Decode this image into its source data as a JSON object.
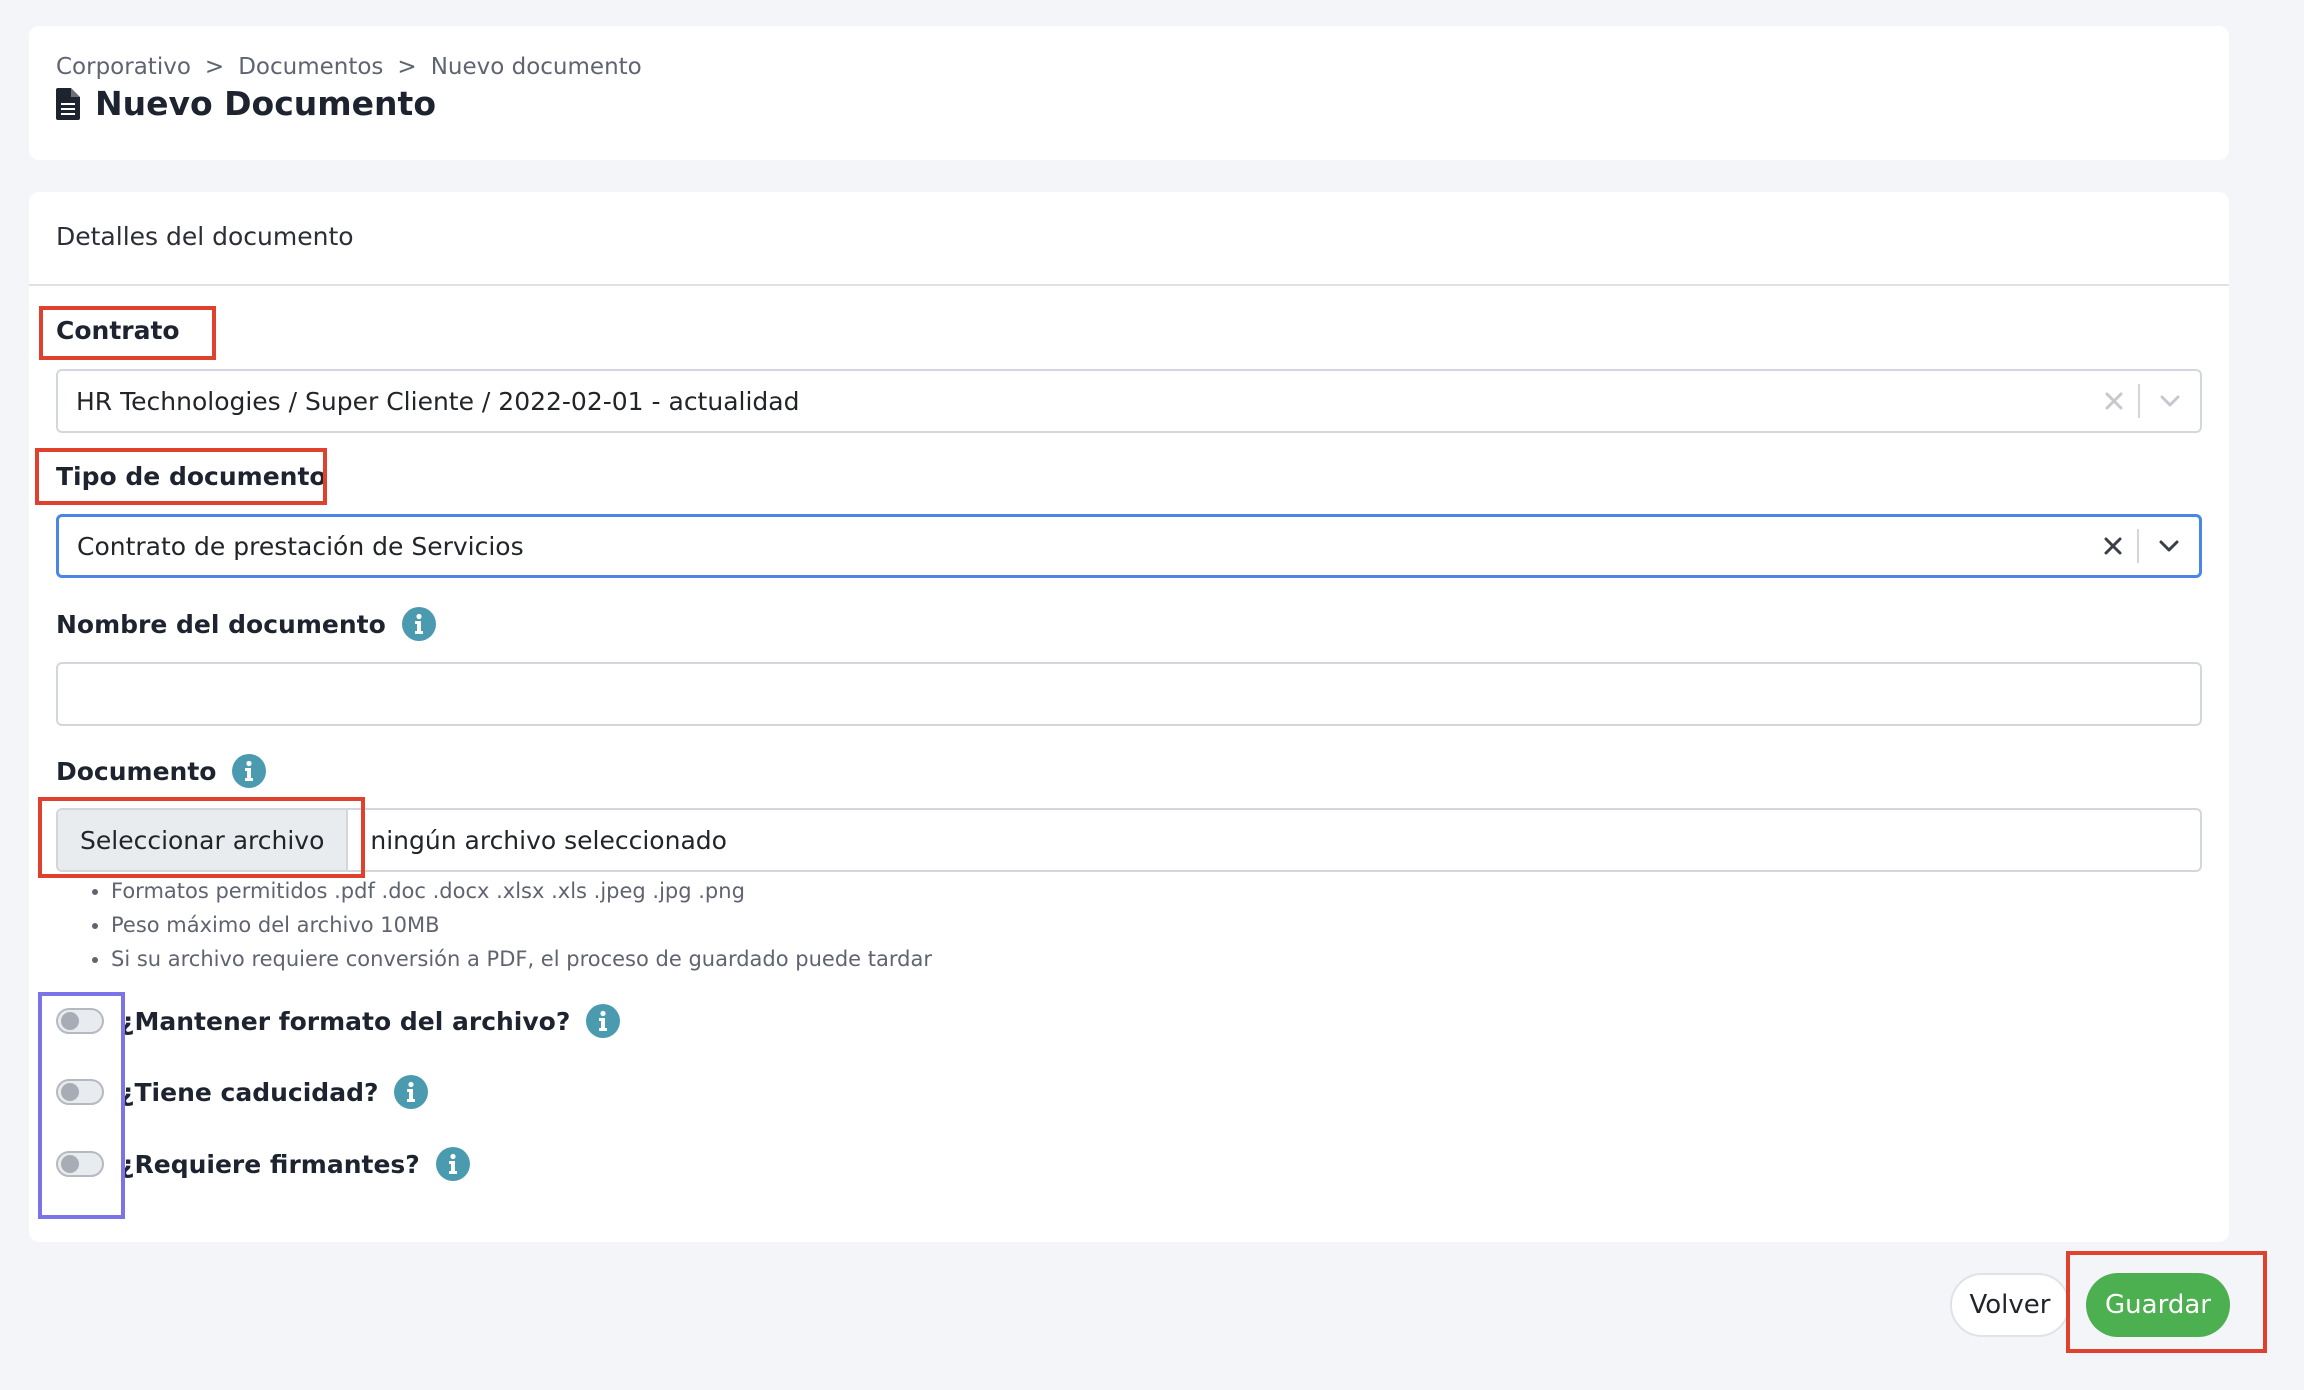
{
  "breadcrumb": {
    "items": [
      "Corporativo",
      "Documentos",
      "Nuevo documento"
    ],
    "separator": ">"
  },
  "page": {
    "title": "Nuevo Documento",
    "title_icon": "document-icon"
  },
  "form": {
    "section_title": "Detalles del documento",
    "contrato": {
      "label": "Contrato",
      "value": "HR Technologies / Super Cliente / 2022-02-01 - actualidad"
    },
    "tipo_documento": {
      "label": "Tipo de documento",
      "value": "Contrato de prestación de Servicios"
    },
    "nombre": {
      "label": "Nombre del documento",
      "value": "",
      "placeholder": ""
    },
    "documento": {
      "label": "Documento",
      "button_label": "Seleccionar archivo",
      "status": "ningún archivo seleccionado",
      "hints": [
        "Formatos permitidos .pdf .doc .docx .xlsx .xls .jpeg .jpg .png",
        "Peso máximo del archivo 10MB",
        "Si su archivo requiere conversión a PDF, el proceso de guardado puede tardar"
      ]
    },
    "toggles": [
      {
        "label": "¿Mantener formato del archivo?",
        "checked": false
      },
      {
        "label": "¿Tiene caducidad?",
        "checked": false
      },
      {
        "label": "¿Requiere firmantes?",
        "checked": false
      }
    ]
  },
  "actions": {
    "back_label": "Volver",
    "save_label": "Guardar"
  },
  "colors": {
    "accent_blue": "#4a86e8",
    "info_teal": "#4a9bb0",
    "save_green": "#4caf50",
    "annotation_red": "#e0412f",
    "annotation_blue": "#7b74e8"
  }
}
